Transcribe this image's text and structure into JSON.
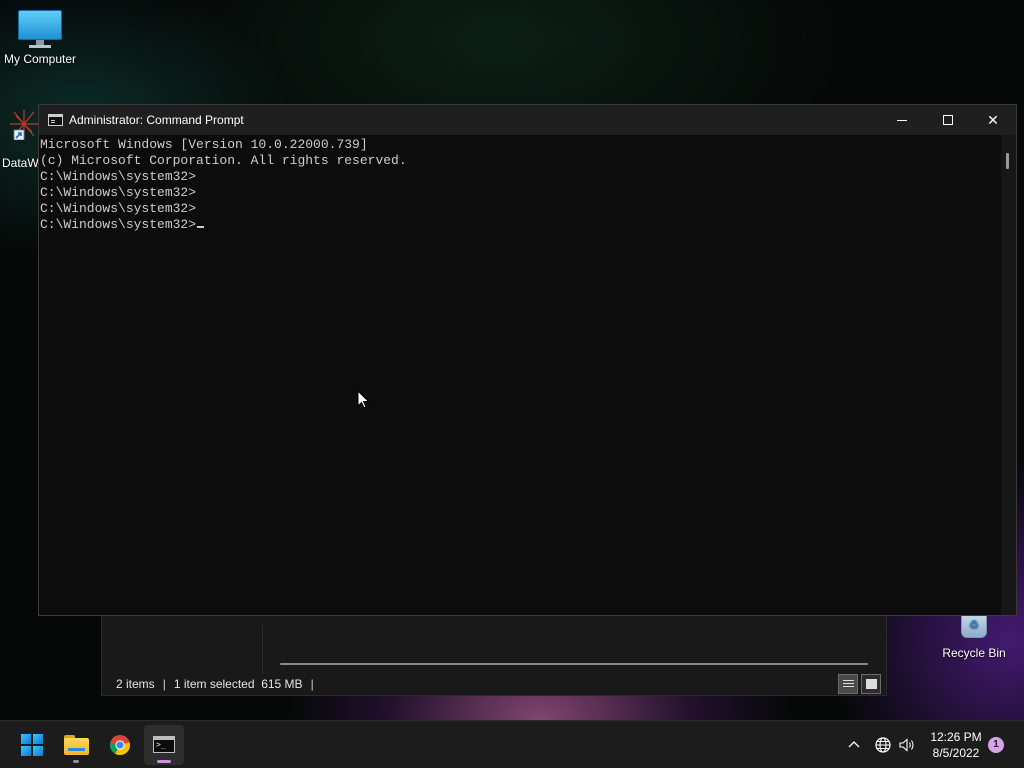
{
  "desktop": {
    "icons": [
      {
        "label": "My Computer"
      },
      {
        "label": "DataW"
      },
      {
        "label": "Recycle Bin"
      }
    ]
  },
  "explorer": {
    "status": {
      "items_count": "2 items",
      "selected": "1 item selected",
      "size": "615 MB",
      "trailing_sep": "|"
    }
  },
  "cmd": {
    "title": "Administrator: Command Prompt",
    "lines": [
      "Microsoft Windows [Version 10.0.22000.739]",
      "(c) Microsoft Corporation. All rights reserved.",
      "",
      "C:\\Windows\\system32>",
      "C:\\Windows\\system32>",
      "C:\\Windows\\system32>",
      "C:\\Windows\\system32>"
    ]
  },
  "taskbar": {
    "apps": [
      "start-icon",
      "file-explorer-icon",
      "chrome-icon",
      "command-prompt-icon"
    ],
    "clock": {
      "time": "12:26 PM",
      "date": "8/5/2022"
    },
    "notifications": "1"
  },
  "colors": {
    "console_text": "#cccccc",
    "console_bg": "#0c0c0c",
    "titlebar_bg": "#1f1f1f",
    "taskbar_bg": "#1c1c1c",
    "notif_badge": "#d8a3e6"
  }
}
